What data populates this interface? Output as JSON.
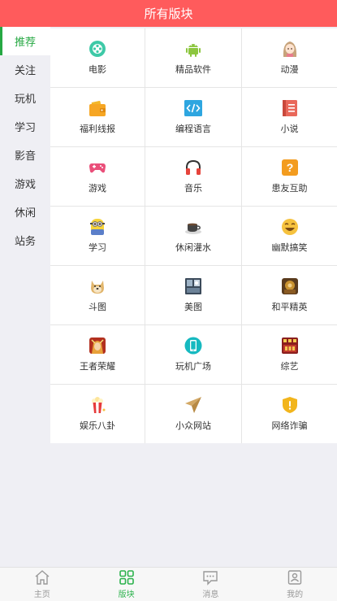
{
  "header": {
    "title": "所有版块"
  },
  "sidebar": {
    "items": [
      {
        "label": "推荐",
        "active": true
      },
      {
        "label": "关注"
      },
      {
        "label": "玩机"
      },
      {
        "label": "学习"
      },
      {
        "label": "影音"
      },
      {
        "label": "游戏"
      },
      {
        "label": "休闲"
      },
      {
        "label": "站务"
      }
    ]
  },
  "boards": [
    {
      "label": "电影",
      "icon": "film-reel-icon"
    },
    {
      "label": "精品软件",
      "icon": "android-icon"
    },
    {
      "label": "动漫",
      "icon": "anime-girl-icon"
    },
    {
      "label": "福利线报",
      "icon": "wallet-icon"
    },
    {
      "label": "编程语言",
      "icon": "code-icon"
    },
    {
      "label": "小说",
      "icon": "book-icon"
    },
    {
      "label": "游戏",
      "icon": "gamepad-icon"
    },
    {
      "label": "音乐",
      "icon": "headphones-icon"
    },
    {
      "label": "患友互助",
      "icon": "question-icon"
    },
    {
      "label": "学习",
      "icon": "minion-icon"
    },
    {
      "label": "休闲灌水",
      "icon": "coffee-cup-icon"
    },
    {
      "label": "幽默搞笑",
      "icon": "laughing-face-icon"
    },
    {
      "label": "斗图",
      "icon": "doge-icon"
    },
    {
      "label": "美图",
      "icon": "photo-icon"
    },
    {
      "label": "和平精英",
      "icon": "peacekeeper-elite-icon"
    },
    {
      "label": "王者荣耀",
      "icon": "honor-of-kings-icon"
    },
    {
      "label": "玩机广场",
      "icon": "phone-icon"
    },
    {
      "label": "综艺",
      "icon": "variety-show-icon"
    },
    {
      "label": "娱乐八卦",
      "icon": "popcorn-icon"
    },
    {
      "label": "小众网站",
      "icon": "paper-plane-icon"
    },
    {
      "label": "网络诈骗",
      "icon": "shield-warning-icon"
    }
  ],
  "tabbar": {
    "items": [
      {
        "label": "主页",
        "icon": "home-icon"
      },
      {
        "label": "版块",
        "icon": "grid-icon",
        "active": true
      },
      {
        "label": "消息",
        "icon": "message-icon"
      },
      {
        "label": "我的",
        "icon": "profile-icon"
      }
    ]
  },
  "colors": {
    "header": "#ff5b5c",
    "accent_green": "#26a843",
    "background": "#efeff4"
  }
}
